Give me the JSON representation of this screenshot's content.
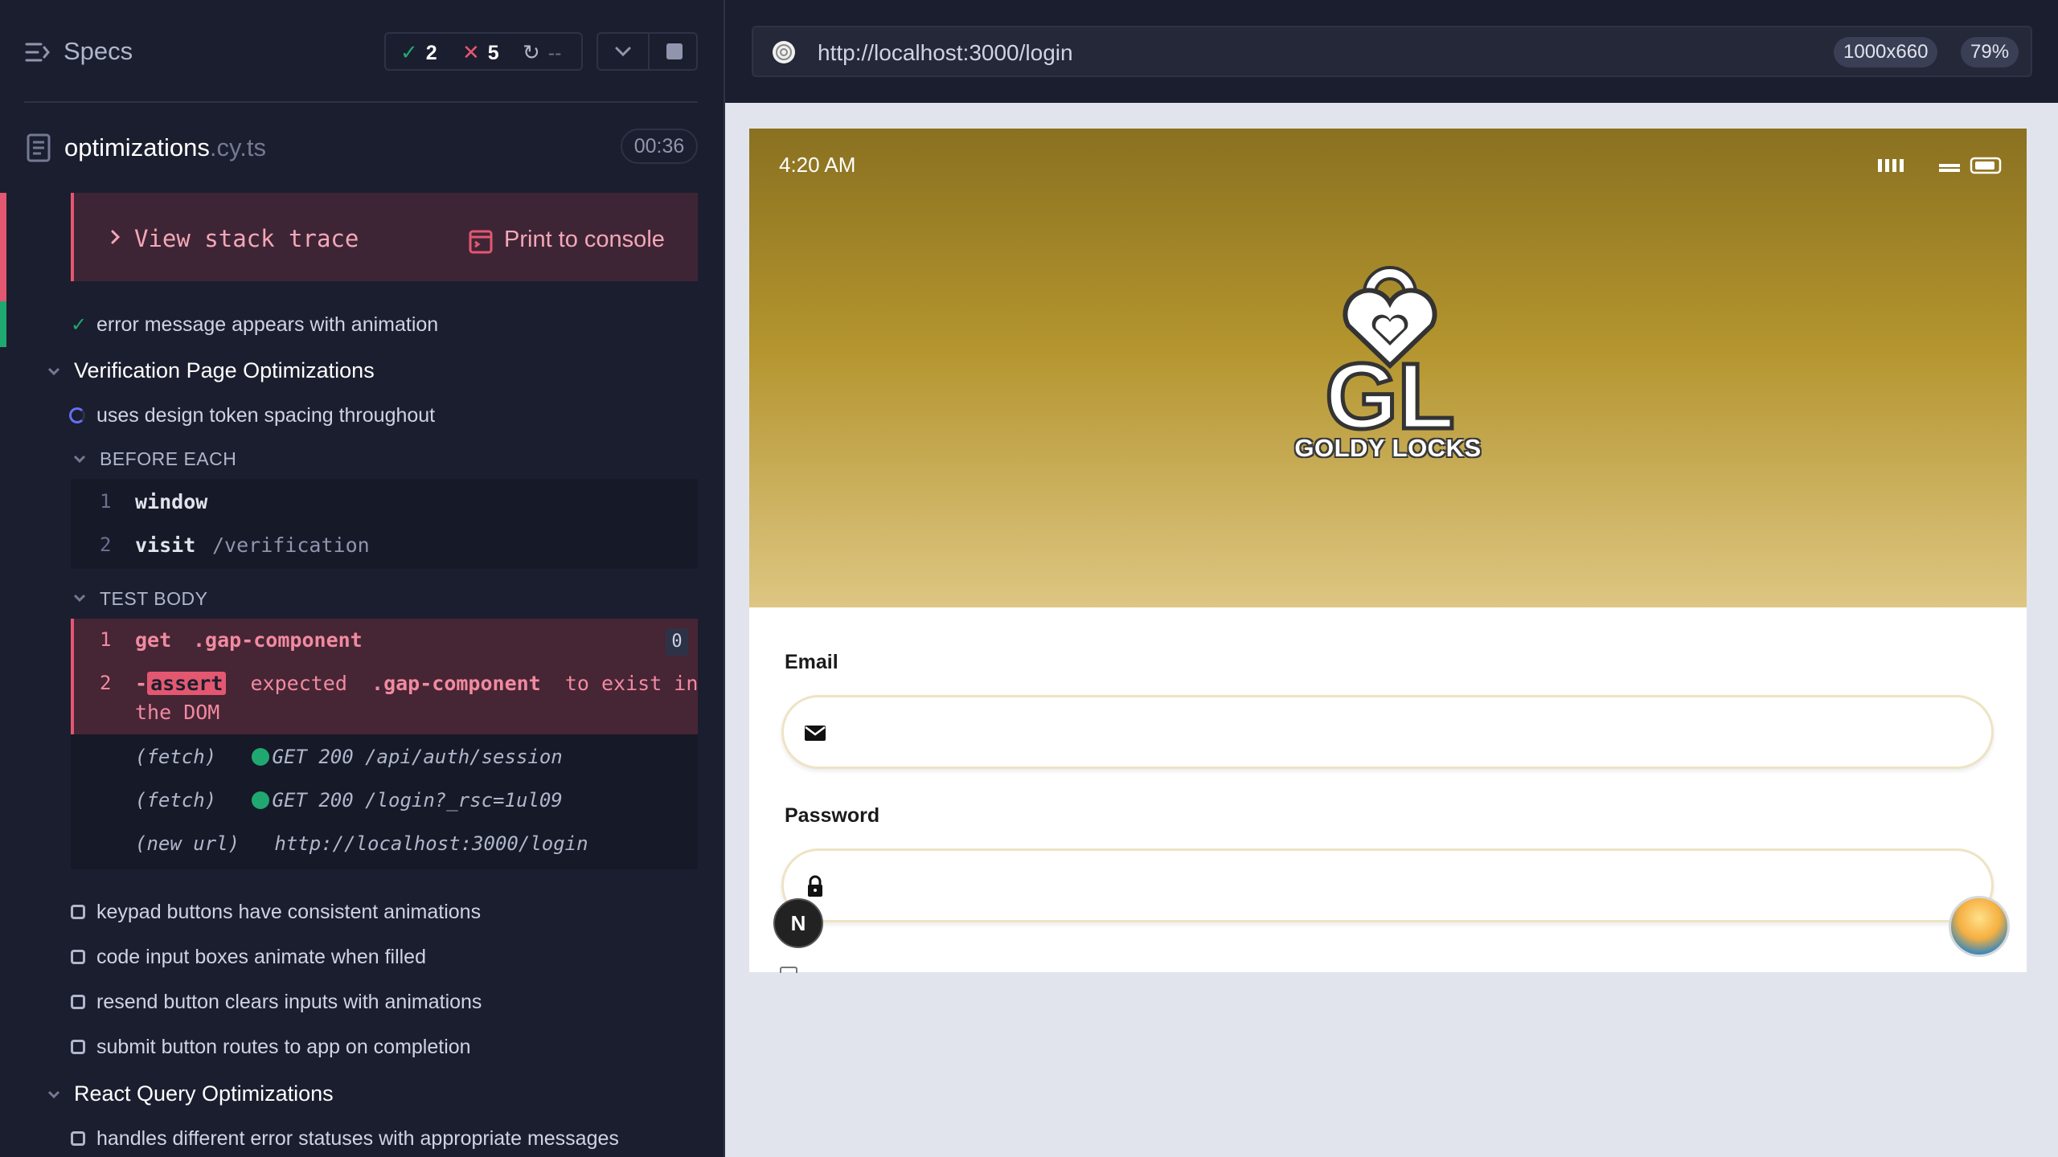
{
  "reporter": {
    "title": "Specs",
    "stats": {
      "passed": "2",
      "failed": "5",
      "pending": "--"
    },
    "spec": {
      "name": "optimizations",
      "ext": ".cy.ts",
      "duration": "00:36"
    },
    "error": {
      "stack_label": "View stack trace",
      "print_label": "Print to console"
    },
    "tests": {
      "error_message": "error message appears with animation",
      "suite_verification": "Verification Page Optimizations",
      "design_tokens": "uses design token spacing throughout",
      "before_each": "BEFORE EACH",
      "test_body": "TEST BODY",
      "keypad": "keypad buttons have consistent animations",
      "code_input": "code input boxes animate when filled",
      "resend": "resend button clears inputs with animations",
      "submit": "submit button routes to app on completion",
      "suite_react_query": "React Query Optimizations",
      "error_statuses": "handles different error statuses with appropriate messages"
    },
    "before_each_commands": [
      {
        "num": "1",
        "name": "window",
        "msg": ""
      },
      {
        "num": "2",
        "name": "visit",
        "msg": "/verification"
      }
    ],
    "body_commands": {
      "cmd1": {
        "num": "1",
        "name": "get",
        "msg": ".gap-component",
        "badge": "0"
      },
      "cmd2": {
        "num": "2",
        "dash": "-",
        "name": "assert",
        "msg_pre": "expected",
        "msg_sel": ".gap-component",
        "msg_post": "to exist in",
        "msg_line2": "the DOM"
      }
    },
    "network": [
      {
        "type": "(fetch)",
        "req": "GET 200 /api/auth/session"
      },
      {
        "type": "(fetch)",
        "req": "GET 200 /login?_rsc=1ul09"
      },
      {
        "type": "(new url)",
        "req": "http://localhost:3000/login"
      }
    ]
  },
  "aut": {
    "url": "http://localhost:3000/login",
    "viewport": "1000x660",
    "zoom": "79%",
    "status_time": "4:20 AM",
    "brand_name": "GOLDY LOCKS",
    "logo_letters": "GL",
    "email_label": "Email",
    "password_label": "Password",
    "next_badge": "N"
  },
  "colors": {
    "pass": "#1fa971",
    "fail": "#e45770",
    "brand_gold": "#b3942d"
  }
}
